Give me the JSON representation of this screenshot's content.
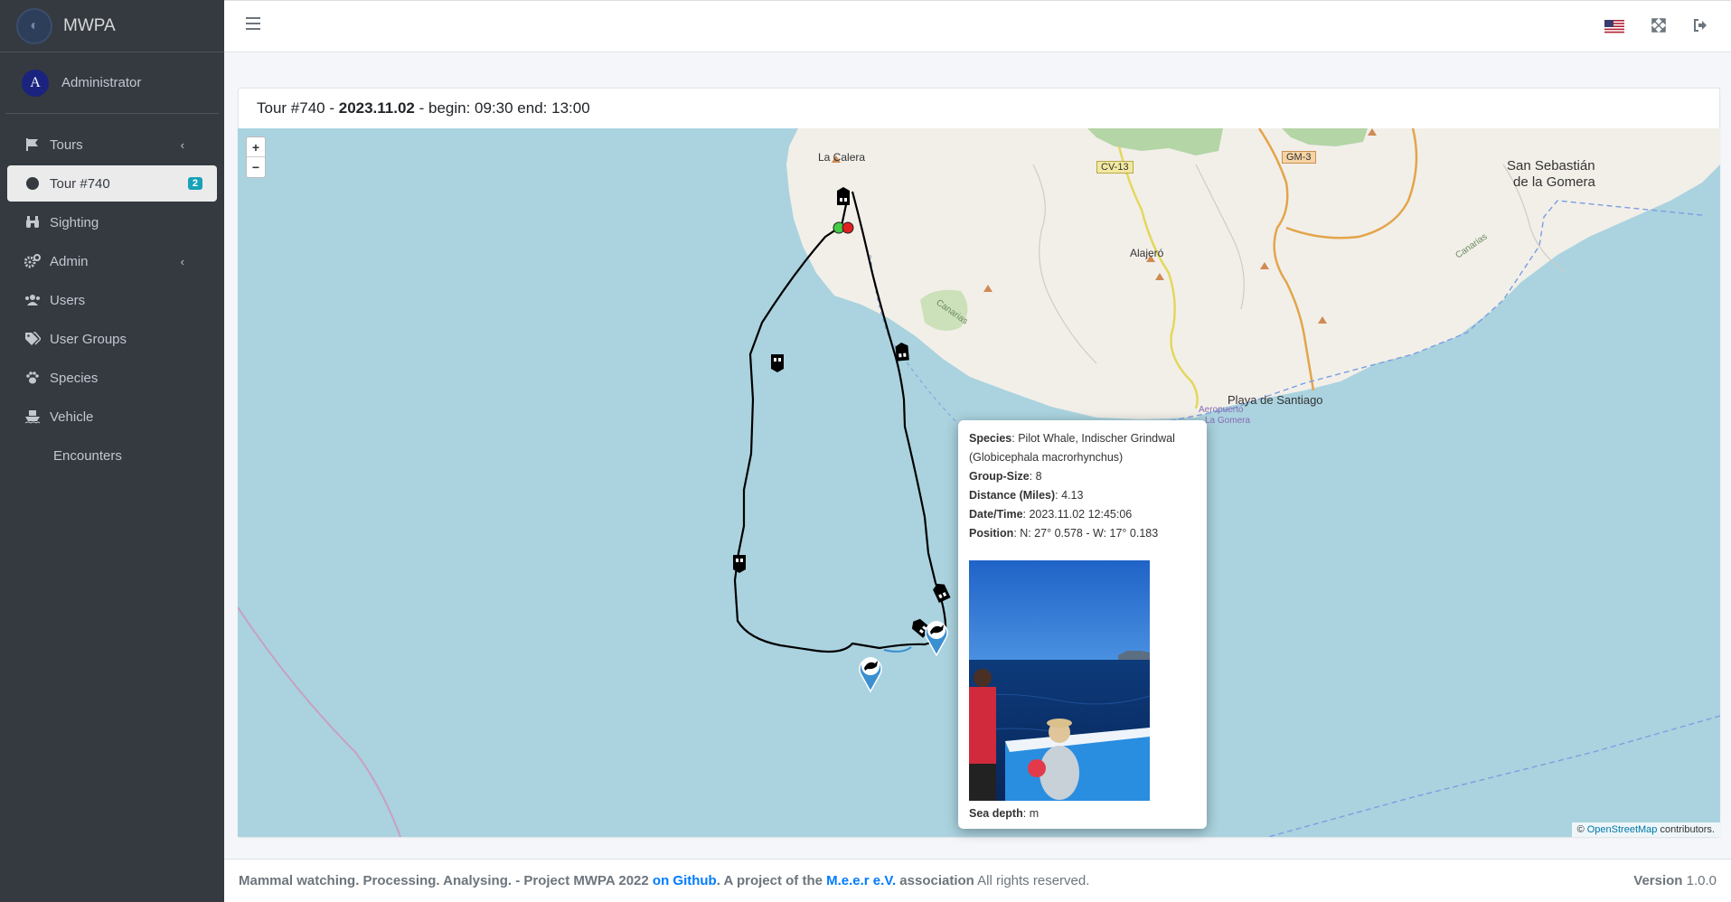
{
  "app": {
    "brand": "MWPA"
  },
  "user": {
    "name": "Administrator",
    "initial": "A"
  },
  "sidebar": {
    "items": [
      {
        "label": "Tours",
        "icon": "flag-icon"
      },
      {
        "label": "Tour #740",
        "icon": "circle-icon",
        "badge": "2"
      },
      {
        "label": "Sighting",
        "icon": "binoculars-icon"
      },
      {
        "label": "Admin",
        "icon": "gears-icon"
      },
      {
        "label": "Users",
        "icon": "users-icon"
      },
      {
        "label": "User Groups",
        "icon": "tags-icon"
      },
      {
        "label": "Species",
        "icon": "paw-icon"
      },
      {
        "label": "Vehicle",
        "icon": "ship-icon"
      },
      {
        "label": "Encounters",
        "icon": ""
      }
    ]
  },
  "card": {
    "prefix": "Tour #740 - ",
    "date": "2023.11.02",
    "suffix": " - begin: 09:30 end: 13:00"
  },
  "map": {
    "zoom_in": "+",
    "zoom_out": "−",
    "places": {
      "la_calera": "La Calera",
      "alajero": "Alajeró",
      "san_sebastian_1": "San Sebastián",
      "san_sebastian_2": "de la Gomera",
      "playa_santiago": "Playa de Santiago",
      "aeropuerto_1": "Aeropuerto",
      "aeropuerto_2": "La Gomera",
      "canarias_1": "Canarias",
      "canarias_2": "Canarias",
      "cv13": "CV-13",
      "gm3": "GM-3"
    },
    "attribution_prefix": "© ",
    "attribution_link": "OpenStreetMap",
    "attribution_suffix": " contributors."
  },
  "popup": {
    "species_label": "Species",
    "species_value": ": Pilot Whale, Indischer Grindwal",
    "species_latin": "(Globicephala macrorhynchus)",
    "group_label": "Group-Size",
    "group_value": ": 8",
    "distance_label": "Distance (Miles)",
    "distance_value": ": 4.13",
    "datetime_label": "Date/Time",
    "datetime_value": ": 2023.11.02 12:45:06",
    "position_label": "Position",
    "position_value": ": N: 27° 0.578 - W: 17° 0.183",
    "depth_label": "Sea depth",
    "depth_value": ": m"
  },
  "footer": {
    "text1": "Mammal watching. Processing. Analysing. - Project MWPA 2022 ",
    "github": "on Github",
    "text2": ".   A project of the ",
    "meer": "M.e.e.r e.V.",
    "text3": " association",
    "rights": " All rights reserved.",
    "version_label": "Version",
    "version_value": " 1.0.0"
  },
  "colors": {
    "sidebar": "#343a40",
    "map_water": "#aad3df",
    "land": "#f2efe9",
    "badge": "#17a2b8",
    "link": "#007bff"
  }
}
